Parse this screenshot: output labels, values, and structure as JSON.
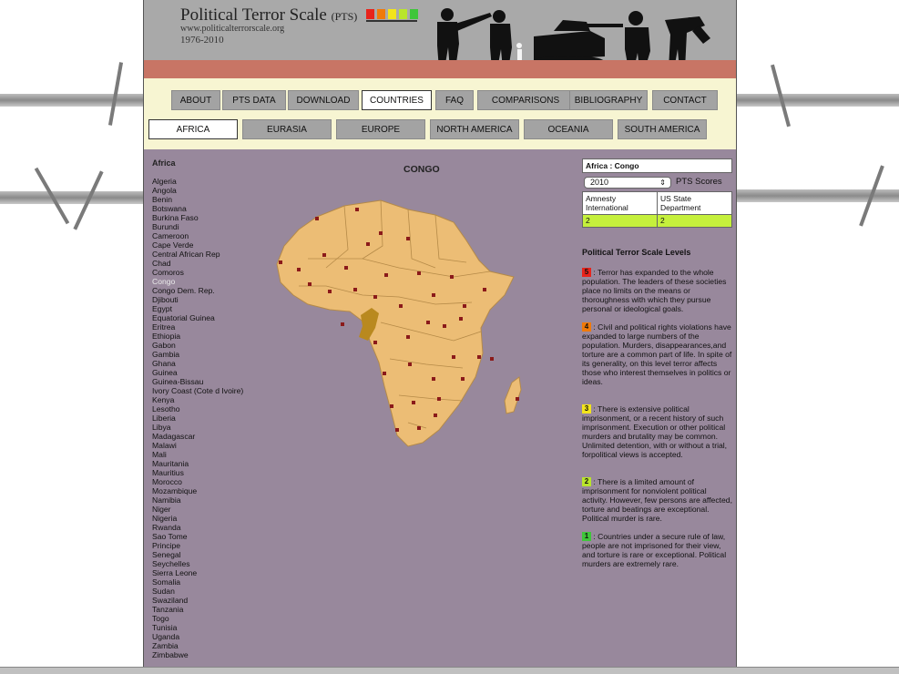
{
  "header": {
    "title": "Political Terror Scale",
    "title_abbrev": "(PTS)",
    "url": "www.politicalterrorscale.org",
    "years": "1976-2010",
    "swatch_colors": [
      "#e8231b",
      "#f07a0a",
      "#f2e41b",
      "#b9e52b",
      "#3fc63a"
    ]
  },
  "nav": {
    "main_tabs": [
      "ABOUT",
      "PTS DATA",
      "DOWNLOAD",
      "COUNTRIES",
      "FAQ",
      "COMPARISONS",
      "BIBLIOGRAPHY",
      "CONTACT"
    ],
    "active_main": "COUNTRIES",
    "region_tabs": [
      "AFRICA",
      "EURASIA",
      "EUROPE",
      "NORTH AMERICA",
      "OCEANIA",
      "SOUTH AMERICA"
    ],
    "active_region": "AFRICA"
  },
  "sidebar": {
    "region_title": "Africa",
    "countries": [
      "Algeria",
      "Angola",
      "Benin",
      "Botswana",
      "Burkina Faso",
      "Burundi",
      "Cameroon",
      "Cape Verde",
      "Central African Rep",
      "Chad",
      "Comoros",
      "Congo",
      "Congo Dem. Rep.",
      "Djibouti",
      "Egypt",
      "Equatorial Guinea",
      "Eritrea",
      "Ethiopia",
      "Gabon",
      "Gambia",
      "Ghana",
      "Guinea",
      "Guinea-Bissau",
      "Ivory Coast (Cote d Ivoire)",
      "Kenya",
      "Lesotho",
      "Liberia",
      "Libya",
      "Madagascar",
      "Malawi",
      "Mali",
      "Mauritania",
      "Mauritius",
      "Morocco",
      "Mozambique",
      "Namibia",
      "Niger",
      "Nigeria",
      "Rwanda",
      "Sao Tome",
      "Principe",
      "Senegal",
      "Seychelles",
      "Sierra Leone",
      "Somalia",
      "Sudan",
      "Swaziland",
      "Tanzania",
      "Togo",
      "Tunisia",
      "Uganda",
      "Zambia",
      "Zimbabwe"
    ],
    "selected": "Congo"
  },
  "map": {
    "title": "CONGO",
    "land_color": "#ecbd75",
    "highlight_color": "#b9891f",
    "marker_color": "#8b1a1a"
  },
  "scores": {
    "heading": "Africa : Congo",
    "year": "2010",
    "label": "PTS Scores",
    "col1_header": "Amnesty International",
    "col2_header": "US State Department",
    "amnesty": "2",
    "us_state": "2",
    "score_color": "#c5f03c"
  },
  "levels": {
    "title": "Political Terror Scale Levels",
    "items": [
      {
        "num": "5",
        "color": "#e8231b",
        "text": ": Terror has expanded to the whole population. The leaders of these societies place no limits on the means or thoroughness with which they pursue personal or ideological goals."
      },
      {
        "num": "4",
        "color": "#f07a0a",
        "text": ": Civil and political rights violations have expanded to large numbers of the population. Murders, disappearances,and torture are a common part of life. In spite of its generality, on this level terror affects those who interest themselves in politics or ideas."
      },
      {
        "num": "3",
        "color": "#f2e41b",
        "text": ": There is extensive political imprisonment, or a recent history of such imprisonment. Execution or other political murders and brutality may be common. Unlimited detention, with or without a trial, forpolitical views is accepted."
      },
      {
        "num": "2",
        "color": "#b9e52b",
        "text": ": There is a limited amount of imprisonment for nonviolent political activity. However, few persons are affected, torture and beatings are exceptional. Political murder is rare."
      },
      {
        "num": "1",
        "color": "#3fc63a",
        "text": ": Countries under a secure rule of law, people are not imprisoned for their view, and torture is rare or exceptional. Political murders are extremely rare."
      }
    ]
  }
}
